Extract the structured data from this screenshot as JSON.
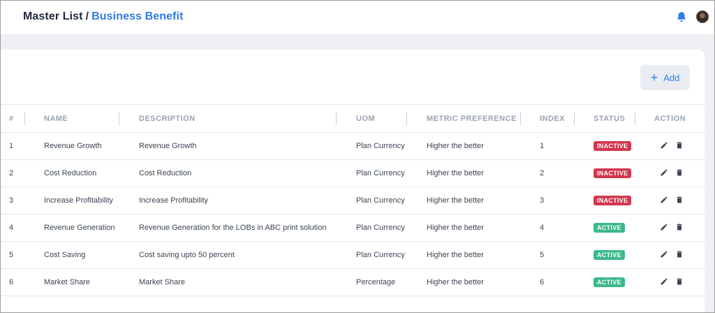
{
  "header": {
    "breadcrumb_root": "Master List",
    "separator": "/",
    "breadcrumb_current": "Business Benefit",
    "notification_icon": "bell-icon",
    "accent_color": "#2f7be5"
  },
  "toolbar": {
    "add_label": "Add",
    "add_icon": "plus-icon"
  },
  "table": {
    "columns": [
      "#",
      "NAME",
      "DESCRIPTION",
      "UOM",
      "METRIC PREFERENCE",
      "INDEX",
      "STATUS",
      "ACTION"
    ],
    "rows": [
      {
        "num": "1",
        "name": "Revenue Growth",
        "description": "Revenue Growth",
        "uom": "Plan Currency",
        "metric": "Higher the better",
        "index": "1",
        "status": "INACTIVE"
      },
      {
        "num": "2",
        "name": "Cost Reduction",
        "description": "Cost Reduction",
        "uom": "Plan Currency",
        "metric": "Higher the better",
        "index": "2",
        "status": "INACTIVE"
      },
      {
        "num": "3",
        "name": "Increase Profitability",
        "description": "Increase Profitability",
        "uom": "Plan Currency",
        "metric": "Higher the better",
        "index": "3",
        "status": "INACTIVE"
      },
      {
        "num": "4",
        "name": "Revenue Generation",
        "description": "Revenue Generation for the LOBs in ABC print solution",
        "uom": "Plan Currency",
        "metric": "Higher the better",
        "index": "4",
        "status": "ACTIVE"
      },
      {
        "num": "5",
        "name": "Cost Saving",
        "description": "Cost saving upto 50 percent",
        "uom": "Plan Currency",
        "metric": "Higher the better",
        "index": "5",
        "status": "ACTIVE"
      },
      {
        "num": "6",
        "name": "Market Share",
        "description": "Market Share",
        "uom": "Percentage",
        "metric": "Higher the better",
        "index": "6",
        "status": "ACTIVE"
      }
    ],
    "status_colors": {
      "ACTIVE": "#3cb98a",
      "INACTIVE": "#d1374f"
    },
    "row_action_icons": [
      "pencil-icon",
      "trash-icon"
    ]
  }
}
